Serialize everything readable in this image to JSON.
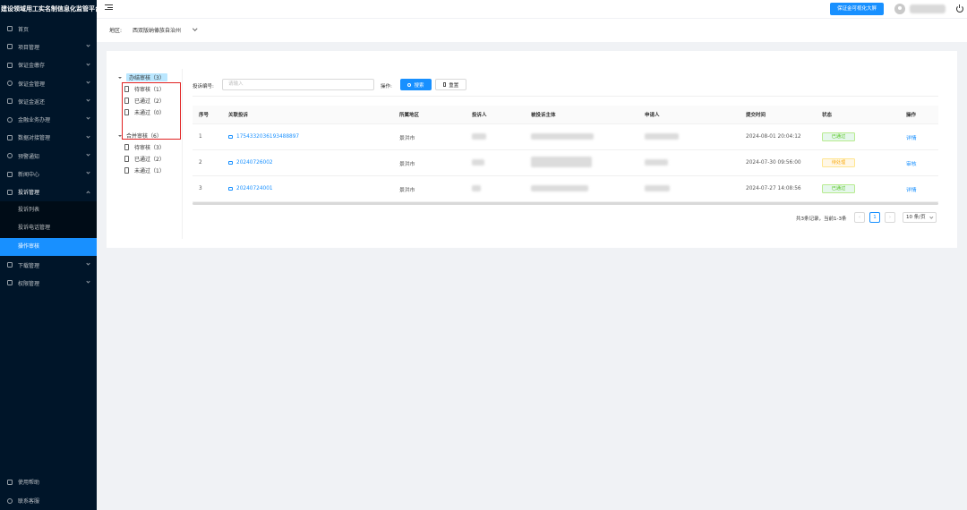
{
  "sidebar": {
    "logo": "建设领域用工实名制信息化监管平台",
    "items": [
      {
        "label": "首页",
        "icon": "home-icon",
        "arrow": false
      },
      {
        "label": "项目管理",
        "icon": "project-icon",
        "arrow": true
      },
      {
        "label": "保证金缴存",
        "icon": "deposit-icon",
        "arrow": true
      },
      {
        "label": "保证金管理",
        "icon": "money-icon",
        "arrow": true
      },
      {
        "label": "保证金返还",
        "icon": "return-icon",
        "arrow": true
      },
      {
        "label": "金融业务办理",
        "icon": "finance-icon",
        "arrow": true
      },
      {
        "label": "数据对接管理",
        "icon": "chart-icon",
        "arrow": true
      },
      {
        "label": "预警通知",
        "icon": "warning-icon",
        "arrow": true
      },
      {
        "label": "新闻中心",
        "icon": "news-icon",
        "arrow": true
      }
    ],
    "open_item": {
      "label": "投诉管理",
      "icon": "complaint-icon"
    },
    "sub_items": [
      {
        "label": "投诉列表"
      },
      {
        "label": "投诉电话管理"
      },
      {
        "label": "操作审核"
      }
    ],
    "items_after": [
      {
        "label": "下载管理",
        "icon": "download-icon"
      },
      {
        "label": "权限管理",
        "icon": "lock-icon"
      }
    ],
    "bottom": [
      {
        "label": "使用帮助",
        "icon": "help-icon"
      },
      {
        "label": "联系客服",
        "icon": "service-icon"
      }
    ]
  },
  "header": {
    "bigscreen_label": "保证金可视化大屏"
  },
  "region": {
    "label": "地区:",
    "value": "西双版纳傣族自治州"
  },
  "tree": {
    "groups": [
      {
        "label": "办结审核（3）",
        "children": [
          "待审核（1）",
          "已通过（2）",
          "未通过（0）"
        ]
      },
      {
        "label": "合并审核（6）",
        "children": [
          "待审核（3）",
          "已通过（2）",
          "未通过（1）"
        ]
      }
    ]
  },
  "filter": {
    "label": "投诉编号:",
    "placeholder": "请输入",
    "op_label": "操作:",
    "search_label": "搜索",
    "reset_label": "重置"
  },
  "table": {
    "columns": [
      "序号",
      "关联投诉",
      "所属地区",
      "投诉人",
      "被投诉主体",
      "申请人",
      "提交时间",
      "状态",
      "操作"
    ],
    "rows": [
      {
        "seq": "1",
        "link": "1754332036193488897",
        "area": "景洪市",
        "time": "2024-08-01 20:04:12",
        "status": "已通过",
        "status_type": "pass",
        "op": "详情"
      },
      {
        "seq": "2",
        "link": "20240726002",
        "area": "景洪市",
        "time": "2024-07-30 09:56:00",
        "status": "待处理",
        "status_type": "pend",
        "op": "审核"
      },
      {
        "seq": "3",
        "link": "20240724001",
        "area": "景洪市",
        "time": "2024-07-27 14:08:56",
        "status": "已通过",
        "status_type": "pass",
        "op": "详情"
      }
    ]
  },
  "pagination": {
    "total_text": "共3条记录，当前1-3条",
    "current": "1",
    "page_size": "10 条/页"
  },
  "colors": {
    "sidebar_bg": "#001529",
    "primary": "#1890ff",
    "highlight": "#e02020"
  }
}
